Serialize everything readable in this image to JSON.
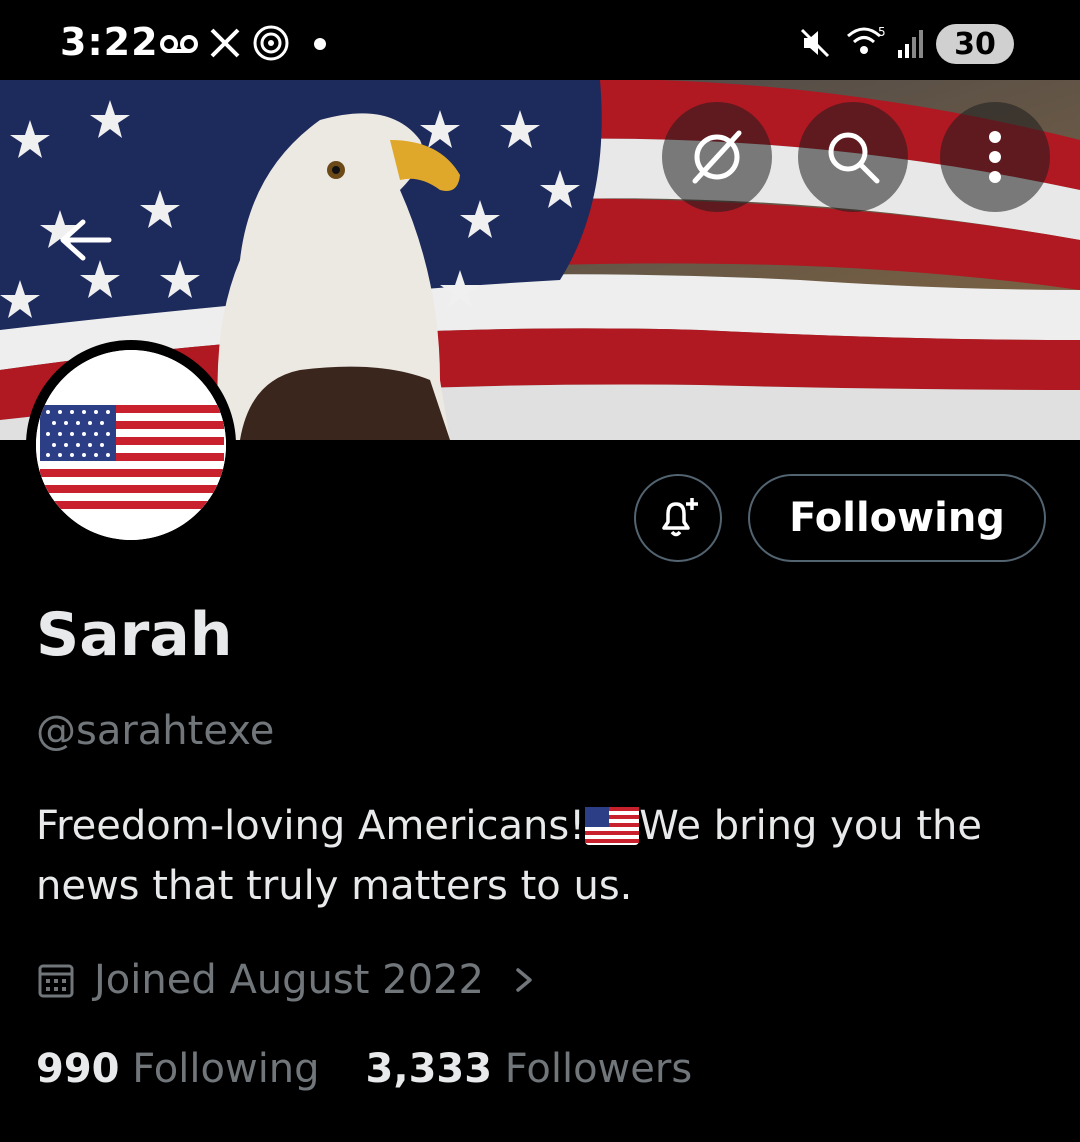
{
  "status_bar": {
    "time": "3:22",
    "battery": "30",
    "icons": [
      "voicemail-icon",
      "x-app-icon",
      "radar-icon",
      "dot-icon",
      "mute-icon",
      "wifi-icon",
      "signal-icon",
      "battery-icon"
    ]
  },
  "header": {
    "banner_theme": "bald eagle over american flag",
    "buttons": [
      "back-arrow-icon",
      "grok-icon",
      "search-icon",
      "more-icon"
    ]
  },
  "profile": {
    "name": "Sarah",
    "handle": "@sarahtexe",
    "bio_part1": "Freedom-loving Americans!",
    "bio_flag": "flag-us-icon",
    "bio_part2": "We bring you the news that truly matters to us.",
    "joined": "Joined August 2022",
    "following_count": "990",
    "following_label": "Following",
    "followers_count": "3,333",
    "followers_label": "Followers"
  },
  "actions": {
    "follow_label": "Following",
    "notify_icon": "bell-plus-icon"
  },
  "colors": {
    "background": "#000000",
    "primary_text": "#e7e9ea",
    "secondary_text": "#71767b",
    "button_border": "#536471"
  }
}
